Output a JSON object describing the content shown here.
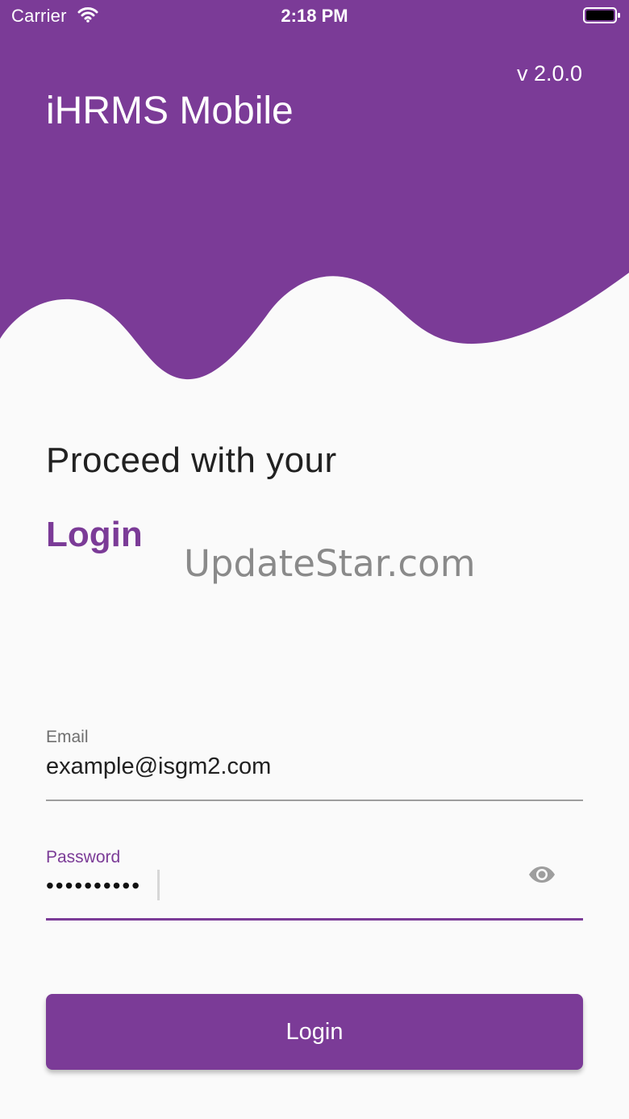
{
  "colors": {
    "primary": "#7b3b97",
    "background": "#fafafa",
    "header_text": "#ffffff",
    "body_text": "#212121",
    "label_text": "#6f6f6f",
    "watermark_text": "#8a8a8a"
  },
  "status_bar": {
    "carrier": "Carrier",
    "time": "2:18 PM",
    "wifi_icon": "wifi-icon",
    "battery_icon": "battery-icon"
  },
  "header": {
    "version": "v 2.0.0",
    "app_title": "iHRMS Mobile"
  },
  "intro": {
    "proceed_text": "Proceed with your",
    "login_heading": "Login"
  },
  "watermark": {
    "text": "UpdateStar.com"
  },
  "form": {
    "email": {
      "label": "Email",
      "value": "example@isgm2.com"
    },
    "password": {
      "label": "Password",
      "value": "••••••••••",
      "visibility_icon": "eye-icon"
    },
    "submit_label": "Login"
  }
}
